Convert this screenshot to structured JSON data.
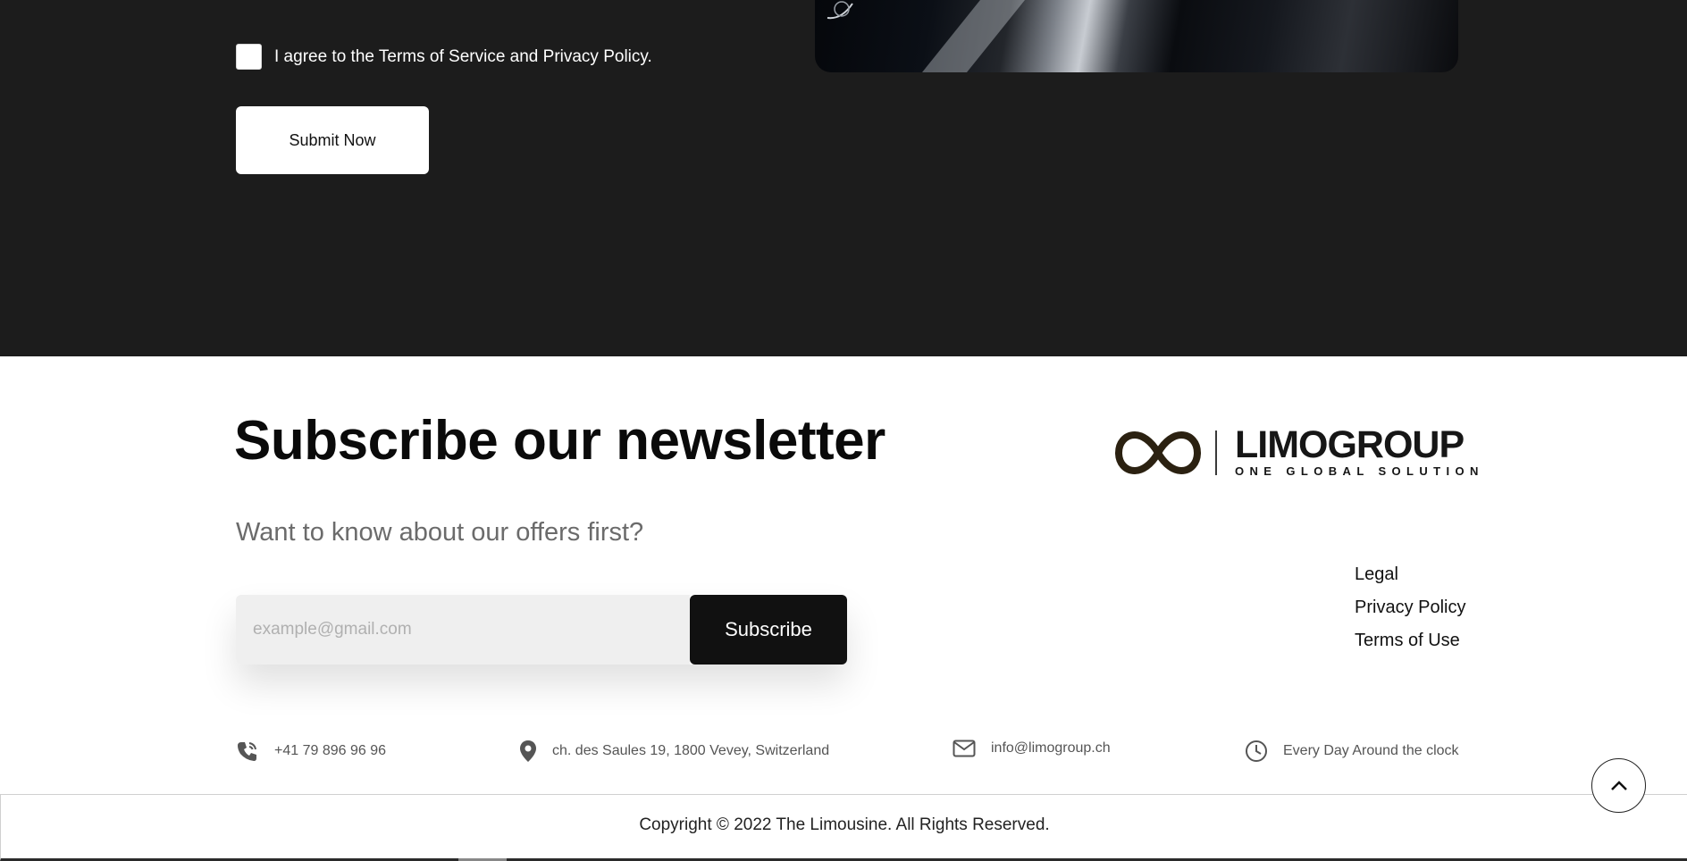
{
  "form": {
    "agree_text": "I agree to the Terms of Service and Privacy Policy.",
    "submit_label": "Submit Now"
  },
  "newsletter": {
    "title": "Subscribe our newsletter",
    "subtitle": "Want to know about our offers first?",
    "email_placeholder": "example@gmail.com",
    "subscribe_label": "Subscribe"
  },
  "logo": {
    "name": "LIMOGROUP",
    "tagline": "ONE GLOBAL SOLUTION",
    "icon": "infinity-icon"
  },
  "footer_links": [
    "Legal",
    "Privacy Policy",
    "Terms of Use"
  ],
  "contacts": {
    "phone": "+41 79 896 96 96",
    "address": "ch. des Saules 19, 1800 Vevey, Switzerland",
    "email": "info@limogroup.ch",
    "hours": "Every Day Around the clock"
  },
  "copyright": "Copyright © 2022 The Limousine. All Rights Reserved.",
  "colors": {
    "dark_bg": "#1c1c1c",
    "button_dark": "#111111",
    "input_bg": "#efefef",
    "logo_brown": "#2b2111"
  }
}
